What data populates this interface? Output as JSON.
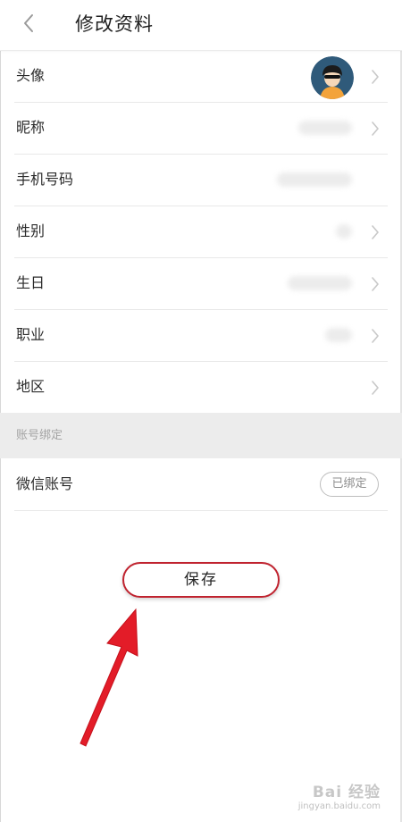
{
  "header": {
    "title": "修改资料",
    "back_icon": "chevron-left-icon"
  },
  "profile_rows": [
    {
      "label": "头像"
    },
    {
      "label": "昵称"
    },
    {
      "label": "手机号码"
    },
    {
      "label": "性别"
    },
    {
      "label": "生日"
    },
    {
      "label": "职业"
    },
    {
      "label": "地区"
    }
  ],
  "account_binding": {
    "section_title": "账号绑定",
    "wechat_label": "微信账号",
    "wechat_status": "已绑定"
  },
  "save_button": {
    "label": "保存"
  },
  "colors": {
    "accent": "#c0232f",
    "arrow": "#e31c28",
    "avatar_bg": "#2f5a7a",
    "section_bg": "#ececec"
  },
  "watermark": {
    "brand": "Bai 经验",
    "url": "jingyan.baidu.com"
  }
}
